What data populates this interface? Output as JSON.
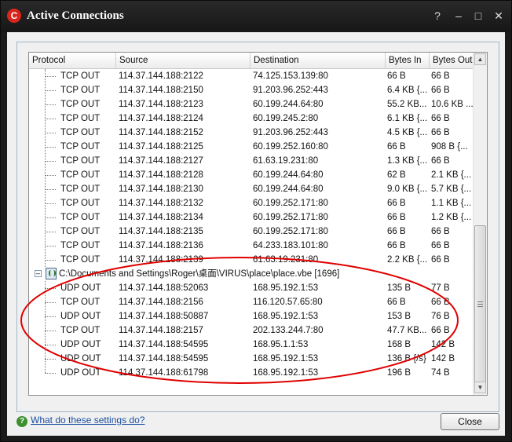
{
  "window": {
    "title": "Active Connections",
    "logo_letter": "C",
    "help_glyph": "?",
    "minimize_glyph": "–",
    "maximize_glyph": "□",
    "close_glyph": "✕"
  },
  "table": {
    "columns": [
      "Protocol",
      "Source",
      "Destination",
      "Bytes In",
      "Bytes Out"
    ],
    "rows_top": [
      {
        "protocol": "TCP OUT",
        "source": "114.37.144.188:2122",
        "destination": "74.125.153.139:80",
        "bytes_in": "66 B",
        "bytes_out": "66 B"
      },
      {
        "protocol": "TCP OUT",
        "source": "114.37.144.188:2150",
        "destination": "91.203.96.252:443",
        "bytes_in": "6.4 KB {...",
        "bytes_out": "66 B"
      },
      {
        "protocol": "TCP OUT",
        "source": "114.37.144.188:2123",
        "destination": "60.199.244.64:80",
        "bytes_in": "55.2 KB...",
        "bytes_out": "10.6 KB ..."
      },
      {
        "protocol": "TCP OUT",
        "source": "114.37.144.188:2124",
        "destination": "60.199.245.2:80",
        "bytes_in": "6.1 KB {...",
        "bytes_out": "66 B"
      },
      {
        "protocol": "TCP OUT",
        "source": "114.37.144.188:2152",
        "destination": "91.203.96.252:443",
        "bytes_in": "4.5 KB {...",
        "bytes_out": "66 B"
      },
      {
        "protocol": "TCP OUT",
        "source": "114.37.144.188:2125",
        "destination": "60.199.252.160:80",
        "bytes_in": "66 B",
        "bytes_out": "908 B {..."
      },
      {
        "protocol": "TCP OUT",
        "source": "114.37.144.188:2127",
        "destination": "61.63.19.231:80",
        "bytes_in": "1.3 KB {...",
        "bytes_out": "66 B"
      },
      {
        "protocol": "TCP OUT",
        "source": "114.37.144.188:2128",
        "destination": "60.199.244.64:80",
        "bytes_in": "62 B",
        "bytes_out": "2.1 KB {..."
      },
      {
        "protocol": "TCP OUT",
        "source": "114.37.144.188:2130",
        "destination": "60.199.244.64:80",
        "bytes_in": "9.0 KB {...",
        "bytes_out": "5.7 KB {..."
      },
      {
        "protocol": "TCP OUT",
        "source": "114.37.144.188:2132",
        "destination": "60.199.252.171:80",
        "bytes_in": "66 B",
        "bytes_out": "1.1 KB {..."
      },
      {
        "protocol": "TCP OUT",
        "source": "114.37.144.188:2134",
        "destination": "60.199.252.171:80",
        "bytes_in": "66 B",
        "bytes_out": "1.2 KB {..."
      },
      {
        "protocol": "TCP OUT",
        "source": "114.37.144.188:2135",
        "destination": "60.199.252.171:80",
        "bytes_in": "66 B",
        "bytes_out": "66 B"
      },
      {
        "protocol": "TCP OUT",
        "source": "114.37.144.188:2136",
        "destination": "64.233.183.101:80",
        "bytes_in": "66 B",
        "bytes_out": "66 B"
      },
      {
        "protocol": "TCP OUT",
        "source": "114.37.144.188:2139",
        "destination": "61.63.19.231:80",
        "bytes_in": "2.2 KB {...",
        "bytes_out": "66 B"
      }
    ],
    "group_label": "C:\\Documents and Settings\\Roger\\桌面\\VIRUS\\place\\place.vbe [1696]",
    "expander_glyph": "–",
    "rows_bottom": [
      {
        "protocol": "UDP OUT",
        "source": "114.37.144.188:52063",
        "destination": "168.95.192.1:53",
        "bytes_in": "135 B",
        "bytes_out": "77 B"
      },
      {
        "protocol": "TCP OUT",
        "source": "114.37.144.188:2156",
        "destination": "116.120.57.65:80",
        "bytes_in": "66 B",
        "bytes_out": "66 B"
      },
      {
        "protocol": "UDP OUT",
        "source": "114.37.144.188:50887",
        "destination": "168.95.192.1:53",
        "bytes_in": "153 B",
        "bytes_out": "76 B"
      },
      {
        "protocol": "TCP OUT",
        "source": "114.37.144.188:2157",
        "destination": "202.133.244.7:80",
        "bytes_in": "47.7 KB...",
        "bytes_out": "66 B"
      },
      {
        "protocol": "UDP OUT",
        "source": "114.37.144.188:54595",
        "destination": "168.95.1.1:53",
        "bytes_in": "168 B",
        "bytes_out": "142 B"
      },
      {
        "protocol": "UDP OUT",
        "source": "114.37.144.188:54595",
        "destination": "168.95.192.1:53",
        "bytes_in": "136 B {/s}",
        "bytes_out": "142 B"
      },
      {
        "protocol": "UDP OUT",
        "source": "114.37.144.188:61798",
        "destination": "168.95.192.1:53",
        "bytes_in": "196 B",
        "bytes_out": "74 B"
      }
    ],
    "scroll_up_glyph": "▲",
    "scroll_down_glyph": "▼"
  },
  "footer": {
    "help_icon_glyph": "?",
    "help_link": "What do these settings do?",
    "close_button": "Close"
  },
  "colors": {
    "annotation_ellipse": "#e00000",
    "brand_red": "#d9261c"
  }
}
